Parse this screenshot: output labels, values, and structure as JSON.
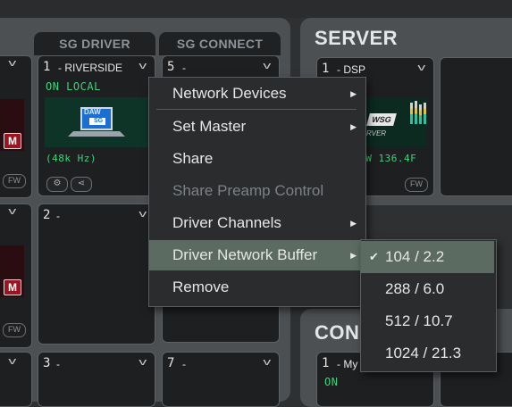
{
  "columns": {
    "driver_header": "SG DRIVER",
    "connect_header": "SG CONNECT",
    "server_title": "SERVER",
    "con_title": "CON"
  },
  "driver_slots": [
    {
      "number": "1",
      "name": "- RIVERSIDE",
      "status": "ON  LOCAL",
      "rate": "(48k Hz)",
      "logo_text": "DAW",
      "logo_sub": "SG"
    },
    {
      "number": "2",
      "name": "-"
    },
    {
      "number": "3",
      "name": "-"
    }
  ],
  "connect_slots": [
    {
      "number": "5",
      "name": "-"
    },
    {
      "number": "7",
      "name": "-"
    }
  ],
  "server_slot": {
    "number": "1",
    "name": "- DSP",
    "status_partial": "C W 136.4F",
    "logo_text": "WSG",
    "logo_sub": "RVER"
  },
  "con_slot": {
    "number": "1",
    "name": "- My",
    "status": "ON"
  },
  "left_badges": [
    "M",
    "M"
  ],
  "fw_label": "FW",
  "context_menu": {
    "items": [
      {
        "label": "Network Devices",
        "submenu": true,
        "enabled": true
      },
      {
        "label": "Set Master",
        "submenu": true,
        "enabled": true
      },
      {
        "label": "Share",
        "submenu": false,
        "enabled": true
      },
      {
        "label": "Share Preamp Control",
        "submenu": false,
        "enabled": false
      },
      {
        "label": "Driver Channels",
        "submenu": true,
        "enabled": true
      },
      {
        "label": "Driver Network Buffer",
        "submenu": true,
        "enabled": true,
        "highlighted": true
      },
      {
        "label": "Remove",
        "submenu": false,
        "enabled": true
      }
    ]
  },
  "buffer_submenu": {
    "items": [
      {
        "label": "104 / 2.2",
        "checked": true
      },
      {
        "label": "288 / 6.0",
        "checked": false
      },
      {
        "label": "512 / 10.7",
        "checked": false
      },
      {
        "label": "1024 / 21.3",
        "checked": false
      }
    ]
  },
  "icons": {
    "submenu_arrow": "▶",
    "checkmark": "✔",
    "chevron": "v",
    "gear": "⚙",
    "share": "⋖"
  },
  "colors": {
    "status_green": "#3ed27a",
    "menu_highlight": "#5b6b61",
    "badge_red": "#9b1420"
  }
}
